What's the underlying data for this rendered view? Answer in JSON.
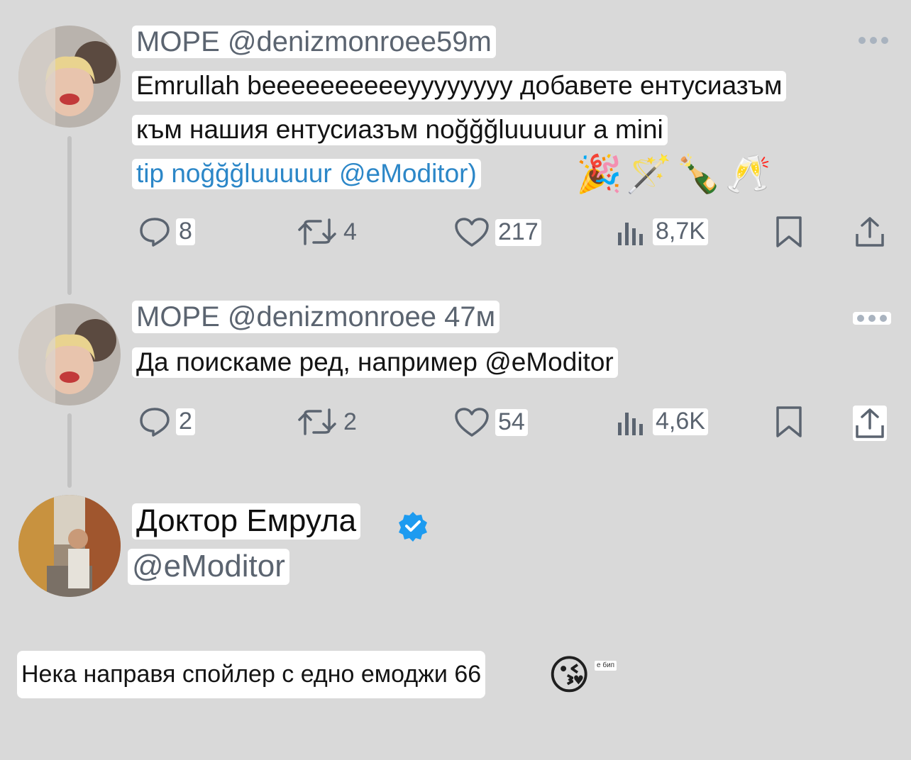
{
  "tweet1": {
    "header": "MOPE @denizmonroee59m",
    "line1": "Emrullah beeeeeeeeeeyyyyyyyy добавете ентусиазъм",
    "line2": "към нашия ентусиазъм noğğğluuuuur a mini",
    "line3": "tip noğğğluuuuur @eModitor)",
    "emojis": [
      "🎉",
      "🪄",
      "🍾",
      "🥂"
    ],
    "replies": "8",
    "retweets": "4",
    "likes": "217",
    "views": "8,7K"
  },
  "tweet2": {
    "header": "MOPE @denizmonroee 47м",
    "line1": "Да поискаме ред, например @eModitor",
    "replies": "2",
    "retweets": "2",
    "likes": "54",
    "views": "4,6K"
  },
  "reply": {
    "display_name": "Доктор Емрула",
    "handle": "@eModitor",
    "verified": true,
    "text": "Нека направя спойлер с едно емоджи 66",
    "emoji": "😘",
    "small_label": "е бип"
  },
  "colors": {
    "background": "#d9d9d9",
    "link": "#2c87c8",
    "verified": "#1d9bf0",
    "icon": "#5b6470"
  },
  "icons": [
    "reply-icon",
    "retweet-icon",
    "like-icon",
    "views-icon",
    "bookmark-icon",
    "share-icon",
    "more-icon",
    "verified-badge-icon"
  ]
}
